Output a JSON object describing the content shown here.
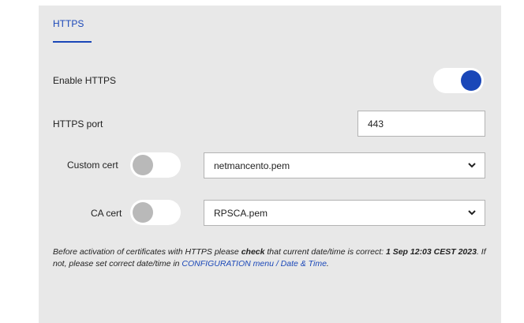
{
  "section": {
    "tab_label": "HTTPS"
  },
  "enable_https": {
    "label": "Enable HTTPS",
    "enabled": true
  },
  "https_port": {
    "label": "HTTPS port",
    "value": "443"
  },
  "custom_cert": {
    "label": "Custom cert",
    "enabled": false,
    "selected": "netmancento.pem"
  },
  "ca_cert": {
    "label": "CA cert",
    "enabled": false,
    "selected": "RPSCA.pem"
  },
  "notice": {
    "part1": "Before activation of certificates with HTTPS please ",
    "check": "check",
    "part2": " that current date/time is correct: ",
    "datetime": "1 Sep 12:03 CEST 2023",
    "part3": ". If not, please set correct date/time in ",
    "link": "CONFIGURATION menu / Date & Time",
    "part4": "."
  },
  "colors": {
    "accent": "#1a47b8",
    "panel": "#e8e8e8",
    "toggle_off_knob": "#b9b9b9"
  }
}
